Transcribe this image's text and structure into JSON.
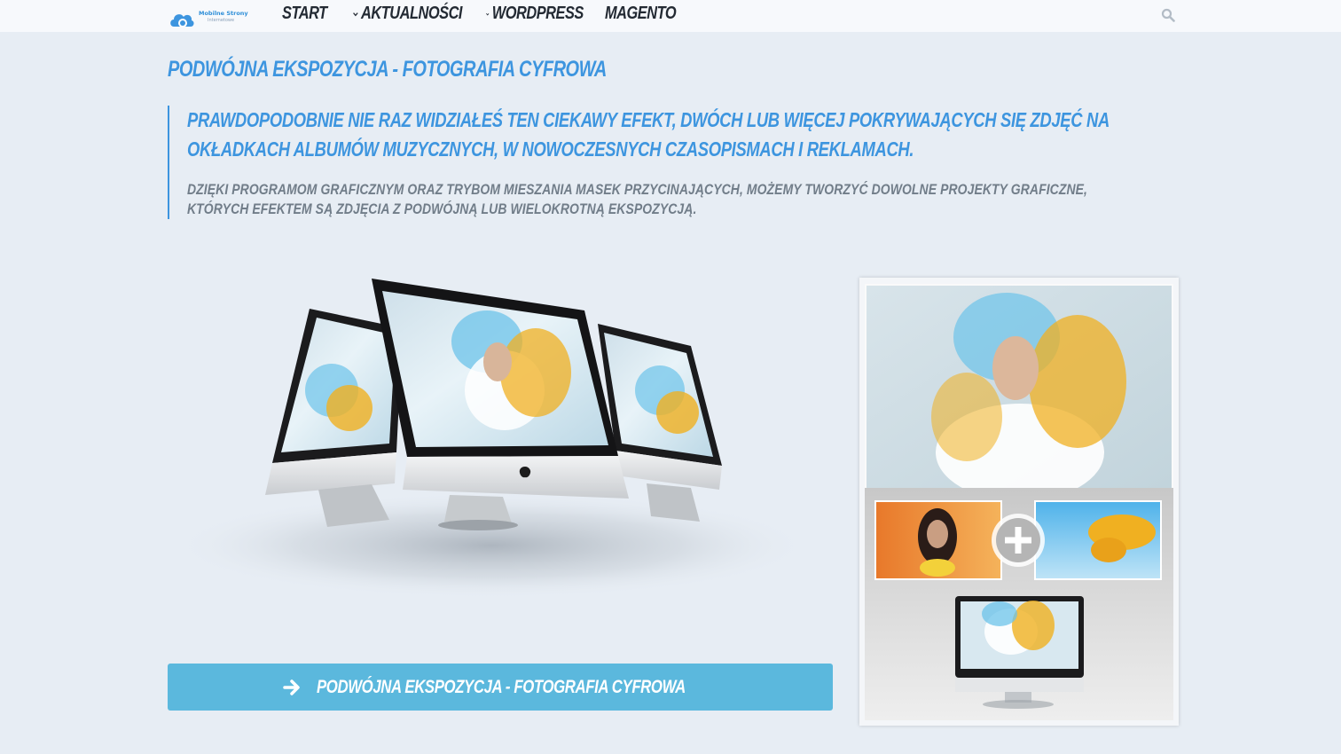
{
  "header": {
    "logo": {
      "line1": "Mobilne Strony",
      "line2": "Internetowe"
    },
    "nav": [
      {
        "label": "START",
        "has_dropdown": false
      },
      {
        "label": "AKTUALNOŚCI",
        "has_dropdown": true
      },
      {
        "label": "WORDPRESS",
        "has_dropdown": true
      },
      {
        "label": "MAGENTO",
        "has_dropdown": false
      }
    ],
    "search_icon": "search-icon"
  },
  "article": {
    "title": "PODWÓJNA EKSPOZYCJA - FOTOGRAFIA CYFROWA",
    "lead": "PRAWDOPODOBNIE NIE RAZ WIDZIAŁEŚ TEN CIEKAWY EFEKT, DWÓCH LUB WIĘCEJ POKRYWAJĄCYCH SIĘ ZDJĘĆ NA OKŁADKACH ALBUMÓW MUZYCZNYCH, W NOWOCZESNYCH CZASOPISMACH I REKLAMACH.",
    "description": "DZIĘKI PROGRAMOM GRAFICZNYM ORAZ TRYBOM MIESZANIA MASEK PRZYCINAJĄCYCH, MOŻEMY TWORZYĆ DOWOLNE PROJEKTY GRAFICZNE, KTÓRYCH EFEKTEM SĄ ZDJĘCIA Z PODWÓJNĄ LUB WIELOKROTNĄ EKSPOZYCJĄ.",
    "cta_label": "PODWÓJNA EKSPOZYCJA - FOTOGRAFIA CYFROWA",
    "cta_icon": "arrow-right-icon"
  },
  "colors": {
    "accent": "#3d95df",
    "button": "#5bb8dd",
    "background": "#e7edf4",
    "nav_text": "#232a33",
    "muted_text": "#717d89"
  }
}
